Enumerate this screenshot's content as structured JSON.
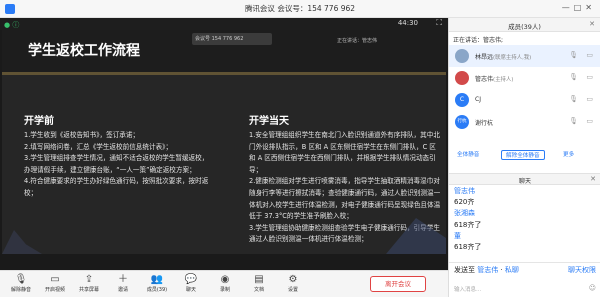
{
  "window": {
    "title": "腾讯会议 会议号：154 776 962"
  },
  "stage": {
    "timer": "44:30",
    "share_text": "正在讲话：管志伟",
    "share_meeting": "会议号 154 776 962",
    "slide": {
      "title": "学生返校工作流程",
      "left_heading": "开学前",
      "left_items": [
        "1.学生收到《返校告知书》，签订承诺；",
        "2.填写网络问卷，汇总《学生返校前信息统计表》；",
        "3.学生管理组排查学生情况，通知不适合返校的学生暂缓返校，办理请假手续，建立健康台账，“一人一策”确定返校方案；",
        "4.符合健康要求的学生办好绿色通行码，按照批次要求，按时返校；"
      ],
      "right_heading": "开学当天",
      "right_items": [
        "1.安全管理组组织学生在南北门入脸识别通道外有序排队，其中北门外设排队指示，B 区和 A 区东侧住宿学生在东侧门排队，C 区和 A 区西侧住宿学生在西侧门排队，并根据学生排队情况动态引导；",
        "2.健康检测组对学生进行喷雾消毒，指导学生抽取酒精消毒湿巾对随身行李等进行擦拭消毒；查验健康通行码，通过人脸识别测温一体机对入校学生进行体温检测，对电子健康通行码呈现绿色且体温低于 37.3°C的学生准予刷脸入校；",
        "3.学生管理组协助健康检测组查验学生电子健康通行码，引导学生通过人脸识别测温一体机进行体温检测；"
      ]
    }
  },
  "toolbar": {
    "items": [
      {
        "icon": "mic-icon",
        "label": "解除静音"
      },
      {
        "icon": "video-icon",
        "label": "开启视频"
      },
      {
        "icon": "share-icon",
        "label": "共享屏幕"
      },
      {
        "icon": "invite-icon",
        "label": "邀请"
      },
      {
        "icon": "members-icon",
        "label": "成员(39)"
      },
      {
        "icon": "chat-icon",
        "label": "聊天"
      },
      {
        "icon": "record-icon",
        "label": "录制"
      },
      {
        "icon": "doc-icon",
        "label": "文档"
      },
      {
        "icon": "settings-icon",
        "label": "设置"
      }
    ],
    "leave_label": "离开会议"
  },
  "panel": {
    "title": "成员(39人)",
    "speaking": "正在讲话：管志伟;",
    "members": [
      {
        "name": "林昂远",
        "role": "(联席主持人,我)",
        "avatar_text": "",
        "avatar_color": "#8aa6c8"
      },
      {
        "name": "管志伟",
        "role": "(主持人)",
        "avatar_text": "",
        "avatar_color": "#d24a4a"
      },
      {
        "name": "CJ",
        "role": "",
        "avatar_text": "C",
        "avatar_color": "#2b7cf6"
      },
      {
        "name": "谢行杭",
        "role": "",
        "avatar_text": "行杭",
        "avatar_color": "#2b7cf6"
      }
    ],
    "actions": {
      "mute_all": "全体静音",
      "unmute_all": "解除全体静音",
      "more": "更多"
    },
    "chat_title": "聊天",
    "chat": [
      {
        "sender": "管志伟",
        "message": "620齐"
      },
      {
        "sender": "张湘森",
        "message": "618齐了"
      },
      {
        "sender": "董",
        "message": "618齐了"
      }
    ],
    "compose": {
      "send_prefix": "发送至",
      "target": "管志伟",
      "mode": "私聊",
      "permission": "聊天权限",
      "placeholder": "输入消息..."
    }
  }
}
